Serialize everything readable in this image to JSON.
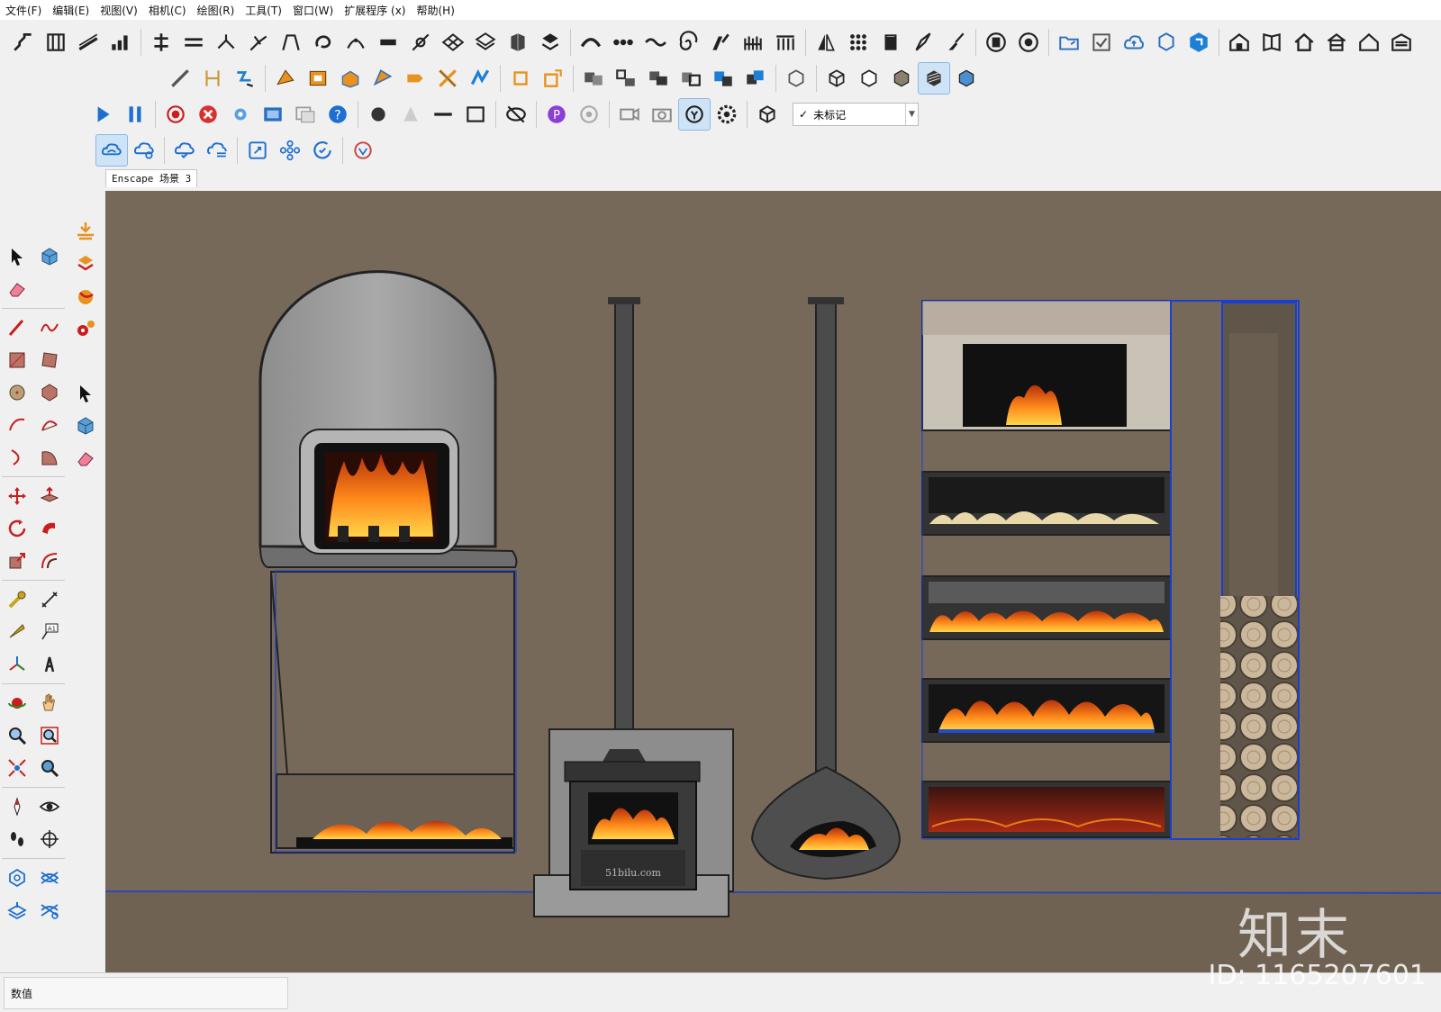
{
  "menu": [
    "文件(F)",
    "编辑(E)",
    "视图(V)",
    "相机(C)",
    "绘图(R)",
    "工具(T)",
    "窗口(W)",
    "扩展程序 (x)",
    "帮助(H)"
  ],
  "tag_dropdown": {
    "label": "未标记",
    "check": "✓"
  },
  "scene_tab": "Enscape 场景 3",
  "status": {
    "measurements_label": "数值"
  },
  "watermark": {
    "brand": "知末",
    "id": "ID: 1165207601",
    "stove_label": "51bilu.com"
  },
  "colors": {
    "wall": "#76695a",
    "floor": "#6f6253",
    "accent_blue": "#1a5fd0",
    "flame": "#f07a12"
  }
}
